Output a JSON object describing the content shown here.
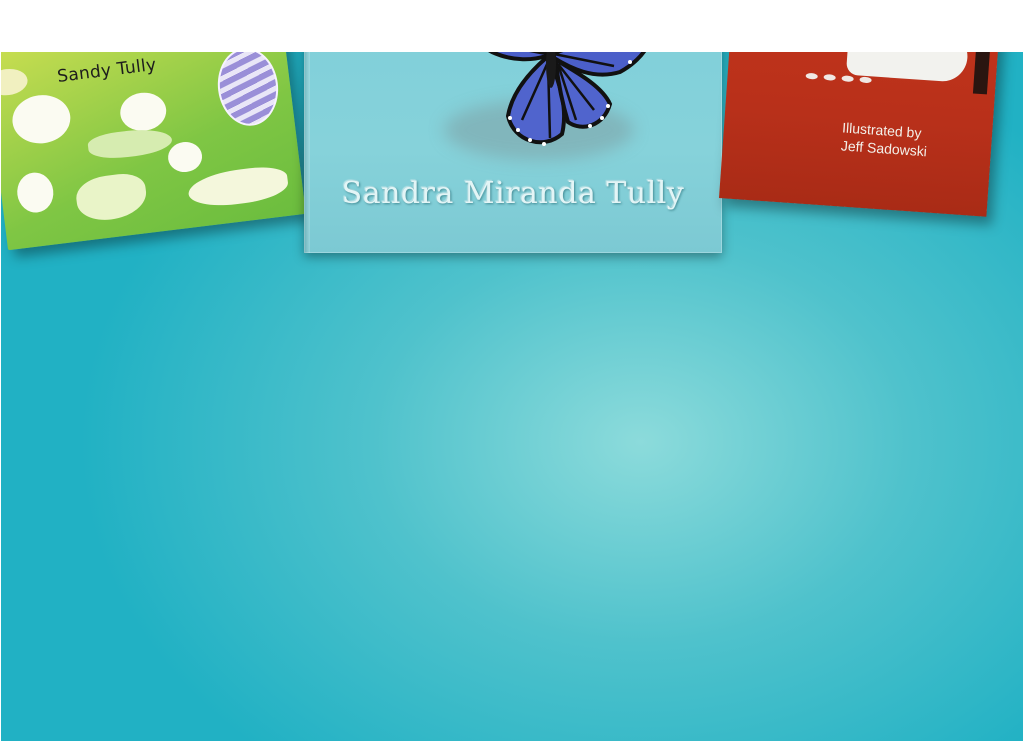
{
  "books": [
    {
      "position": "left",
      "author": "Sandy Tully",
      "colors": {
        "primary": "#7fc644",
        "accent": "#f3ec54"
      }
    },
    {
      "position": "center",
      "author": "Sandra Miranda Tully",
      "icon": "butterfly-icon",
      "colors": {
        "primary": "#86d2da",
        "butterfly": "#4a5fc8"
      }
    },
    {
      "position": "right",
      "credit_line1": "Illustrated by",
      "credit_line2": "Jeff Sadowski",
      "colors": {
        "primary": "#b8301a"
      }
    }
  ],
  "background": {
    "colors": {
      "center": "#8cdbdb",
      "edge": "#21b1c4"
    }
  }
}
